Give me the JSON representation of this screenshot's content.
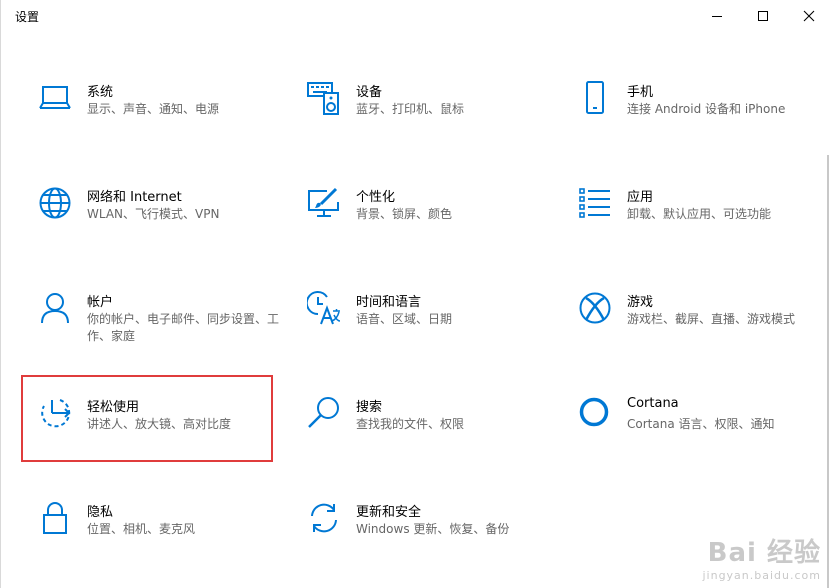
{
  "window": {
    "title": "设置",
    "accent_color": "#0078d4",
    "highlight_color": "#e03c3c"
  },
  "categories": [
    {
      "name": "系统",
      "desc": "显示、声音、通知、电源",
      "icon": "laptop-icon"
    },
    {
      "name": "设备",
      "desc": "蓝牙、打印机、鼠标",
      "icon": "keyboard-speaker-icon"
    },
    {
      "name": "手机",
      "desc": "连接 Android 设备和 iPhone",
      "icon": "phone-icon"
    },
    {
      "name": "网络和 Internet",
      "desc": "WLAN、飞行模式、VPN",
      "icon": "globe-icon"
    },
    {
      "name": "个性化",
      "desc": "背景、锁屏、颜色",
      "icon": "paint-screen-icon"
    },
    {
      "name": "应用",
      "desc": "卸载、默认应用、可选功能",
      "icon": "apps-list-icon"
    },
    {
      "name": "帐户",
      "desc": "你的帐户、电子邮件、同步设置、工作、家庭",
      "icon": "person-icon"
    },
    {
      "name": "时间和语言",
      "desc": "语音、区域、日期",
      "icon": "time-language-icon"
    },
    {
      "name": "游戏",
      "desc": "游戏栏、截屏、直播、游戏模式",
      "icon": "xbox-icon"
    },
    {
      "name": "轻松使用",
      "desc": "讲述人、放大镜、高对比度",
      "icon": "ease-of-access-icon"
    },
    {
      "name": "搜索",
      "desc": "查找我的文件、权限",
      "icon": "search-icon"
    },
    {
      "name": "Cortana",
      "desc": "Cortana 语言、权限、通知",
      "icon": "cortana-icon"
    },
    {
      "name": "隐私",
      "desc": "位置、相机、麦克风",
      "icon": "lock-icon"
    },
    {
      "name": "更新和安全",
      "desc": "Windows 更新、恢复、备份",
      "icon": "sync-icon"
    }
  ],
  "watermark": {
    "main": "Bai 经验",
    "sub": "jingyan.baidu.com"
  }
}
